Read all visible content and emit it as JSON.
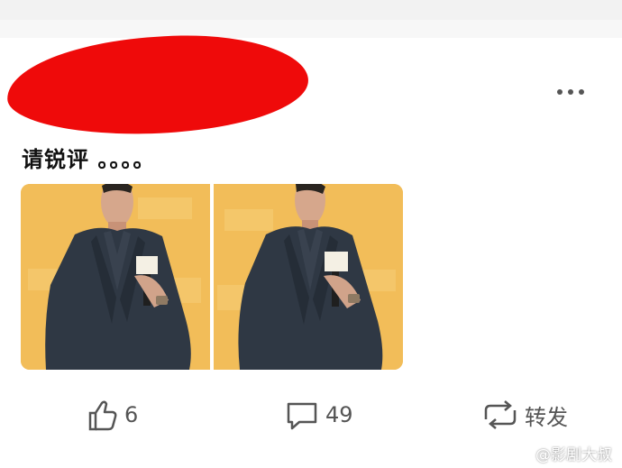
{
  "post": {
    "text": "请锐评 。。。。"
  },
  "actions": {
    "like_count": "6",
    "comment_count": "49",
    "repost_label": "转发"
  },
  "watermark": {
    "text": "@影剧大叔"
  },
  "colors": {
    "redaction": "#ef0a0a",
    "photo_bg": "#f2bd59",
    "suit": "#2f3844",
    "icon": "#555555"
  },
  "icons": {
    "more": "more-dots-icon",
    "like": "thumbs-up-icon",
    "comment": "comment-bubble-icon",
    "repost": "repost-arrows-icon",
    "watermark": "weibo-logo-icon"
  }
}
